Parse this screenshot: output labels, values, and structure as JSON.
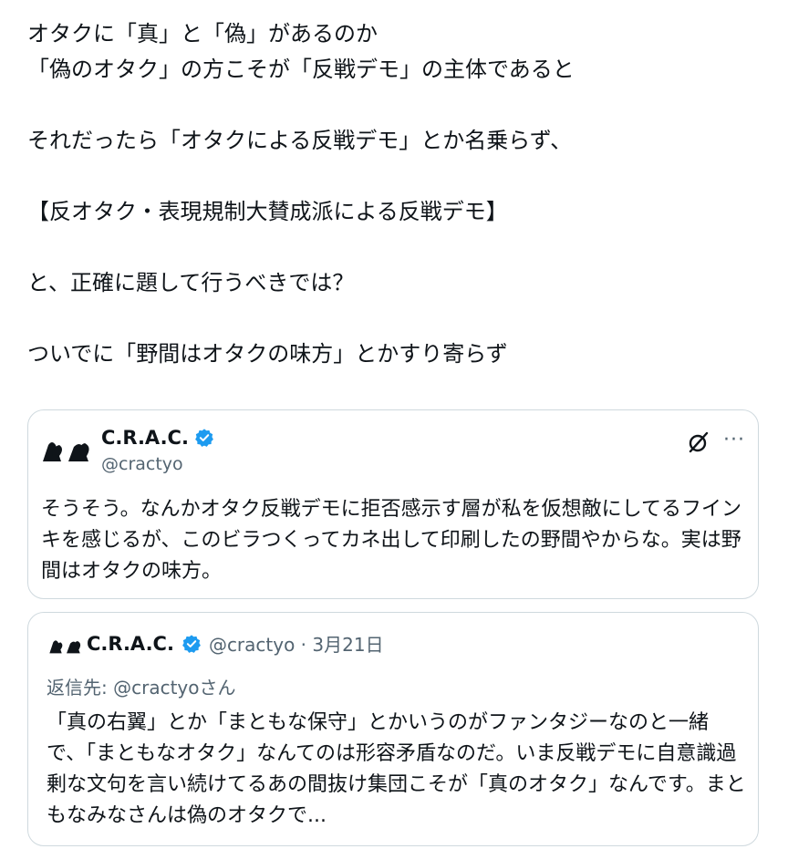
{
  "post": {
    "lines": [
      "オタクに「真」と「偽」があるのか",
      "「偽のオタク」の方こそが「反戦デモ」の主体であると",
      "",
      "それだったら「オタクによる反戦デモ」とか名乗らず、",
      "",
      "【反オタク・表現規制大賛成派による反戦デモ】",
      "",
      "と、正確に題して行うべきでは？",
      "",
      "ついでに「野間はオタクの味方」とかすり寄らず"
    ]
  },
  "quote1": {
    "display_name": "C.R.A.C.",
    "handle": "@cractyo",
    "more_label": "···",
    "text": "そうそう。なんかオタク反戦デモに拒否感示す層が私を仮想敵にしてるフインキを感じるが、このビラつくってカネ出して印刷したの野間やからな。実は野間はオタクの味方。"
  },
  "quote2": {
    "display_name": "C.R.A.C.",
    "handle_date": "@cractyo · 3月21日",
    "reply_to": "返信先: @cractyoさん",
    "text": "「真の右翼」とか「まともな保守」とかいうのがファンタジーなのと一緒で、「まともなオタク」なんてのは形容矛盾なのだ。いま反戦デモに自意識過剰な文句を言い続けてるあの間抜け集団こそが「真のオタク」なんです。まともなみなさんは偽のオタクで..."
  },
  "colors": {
    "text": "#0f1419",
    "secondary": "#536471",
    "border": "#cfd9de",
    "verified": "#1d9bf0"
  },
  "icons": [
    "avatar-logo",
    "verified-badge-icon",
    "grok-icon",
    "more-icon"
  ]
}
